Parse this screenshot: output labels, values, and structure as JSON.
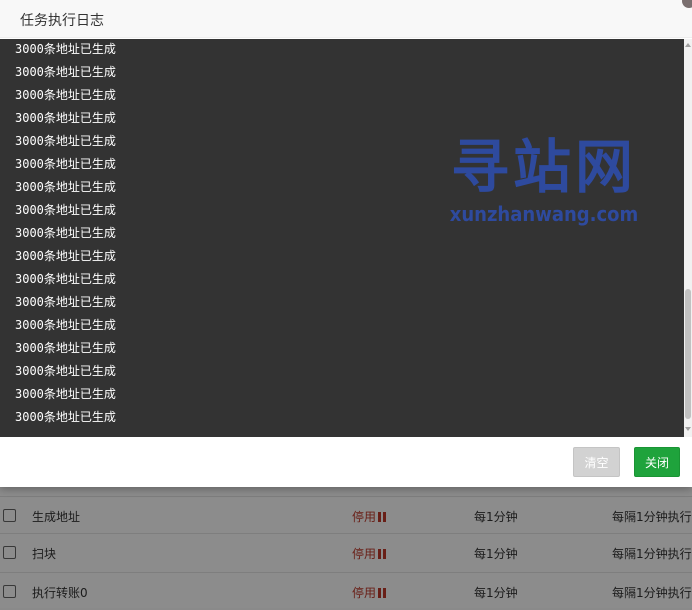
{
  "modal": {
    "title": "任务执行日志",
    "log_lines": [
      "3000条地址已生成",
      "3000条地址已生成",
      "3000条地址已生成",
      "3000条地址已生成",
      "3000条地址已生成",
      "3000条地址已生成",
      "3000条地址已生成",
      "3000条地址已生成",
      "3000条地址已生成",
      "3000条地址已生成",
      "3000条地址已生成",
      "3000条地址已生成",
      "3000条地址已生成",
      "3000条地址已生成",
      "3000条地址已生成",
      "3000条地址已生成",
      "3000条地址已生成"
    ],
    "clear_label": "清空",
    "close_label": "关闭"
  },
  "watermark": {
    "main": "寻站网",
    "sub": "xunzhanwang.com"
  },
  "background_table": {
    "rows": [
      {
        "name": "生成地址",
        "status": "停用",
        "frequency": "每1分钟",
        "description": "每隔1分钟执行"
      },
      {
        "name": "扫块",
        "status": "停用",
        "frequency": "每1分钟",
        "description": "每隔1分钟执行"
      },
      {
        "name": "执行转账0",
        "status": "停用",
        "frequency": "每1分钟",
        "description": "每隔1分钟执行"
      }
    ]
  },
  "colors": {
    "log_background": "#333333",
    "primary_button": "#1fa33c",
    "status_stopped": "#c0392b",
    "watermark": "#2e4a9e"
  },
  "icons": {
    "pause": "pause-icon",
    "close": "close-icon"
  }
}
